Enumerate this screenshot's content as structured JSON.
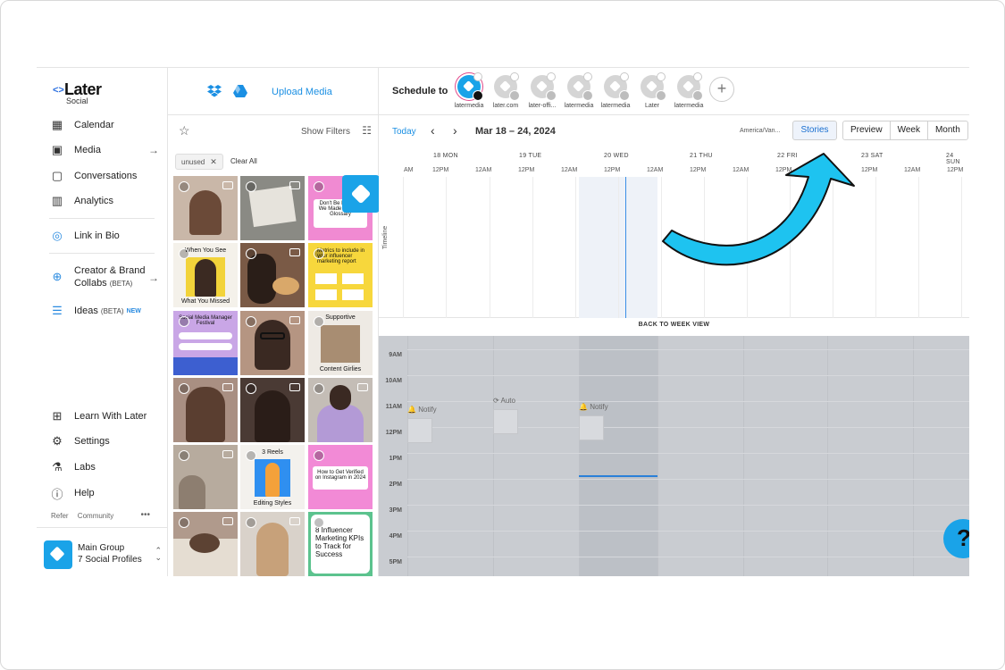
{
  "sidebar": {
    "logo": "Later",
    "logo_sub": "Social",
    "items": [
      {
        "label": "Calendar",
        "icon": "calendar-icon"
      },
      {
        "label": "Media",
        "icon": "media-icon"
      },
      {
        "label": "Conversations",
        "icon": "conversations-icon"
      },
      {
        "label": "Analytics",
        "icon": "analytics-icon"
      },
      {
        "label": "Link in Bio",
        "icon": "link-in-bio-icon"
      },
      {
        "label": "Creator & Brand",
        "label2": "Collabs",
        "beta": "(BETA)",
        "icon": "collabs-icon"
      },
      {
        "label": "Ideas",
        "beta": "(BETA)",
        "new": "NEW",
        "icon": "ideas-icon"
      },
      {
        "label": "Learn With Later",
        "icon": "book-icon"
      },
      {
        "label": "Settings",
        "icon": "gear-icon"
      },
      {
        "label": "Labs",
        "icon": "flask-icon"
      },
      {
        "label": "Help",
        "icon": "help-icon"
      }
    ],
    "footer_links": [
      "Refer",
      "Community"
    ],
    "group": {
      "name": "Main Group",
      "sub": "7 Social Profiles"
    }
  },
  "media": {
    "upload_label": "Upload Media",
    "show_filters": "Show Filters",
    "chip": "unused",
    "clear_all": "Clear All",
    "tile_captions": {
      "t4": "When You See",
      "t4b": "What You Missed",
      "t3": "Don't Be Embar... We Made a Media Glossary",
      "t6": "Metrics to include in your influencer marketing report",
      "t7": "Social Media Manager Festival",
      "t9": "Supportive",
      "t9b": "Content Girlies",
      "t14": "3 Reels",
      "t14b": "Editing Styles",
      "t15": "How to Get Verified on Instagram in 2024",
      "t18": "8 Influencer Marketing KPIs to Track for Success"
    }
  },
  "calendar": {
    "schedule_to": "Schedule to",
    "profiles": [
      "latermedia",
      "later.com",
      "later-offi...",
      "latermedia",
      "latermedia",
      "Later",
      "latermedia"
    ],
    "today": "Today",
    "date_range": "Mar 18 – 24, 2024",
    "timezone": "America/Van...",
    "stories": "Stories",
    "views": [
      "Preview",
      "Week",
      "Month"
    ],
    "days": [
      "18 MON",
      "19 TUE",
      "20 WED",
      "21 THU",
      "22 FRI",
      "23 SAT",
      "24 SUN"
    ],
    "timeline_label": "Timeline",
    "back_to_week": "BACK TO WEEK VIEW",
    "times": [
      "9AM",
      "10AM",
      "11AM",
      "12PM",
      "1PM",
      "2PM",
      "3PM",
      "4PM",
      "5PM"
    ],
    "events": [
      {
        "label": "Notify"
      },
      {
        "label": "Auto"
      },
      {
        "label": "Notify"
      }
    ],
    "hour_labels": [
      "AM",
      "12PM",
      "12AM",
      "12PM",
      "12AM",
      "12PM",
      "12AM",
      "12PM",
      "12AM",
      "12PM",
      "12AM",
      "12PM",
      "12AM",
      "12PM"
    ]
  },
  "colors": {
    "accent": "#1aa3e8",
    "link": "#1a8fe3",
    "annotation_arrow": "#1ec3f0"
  }
}
